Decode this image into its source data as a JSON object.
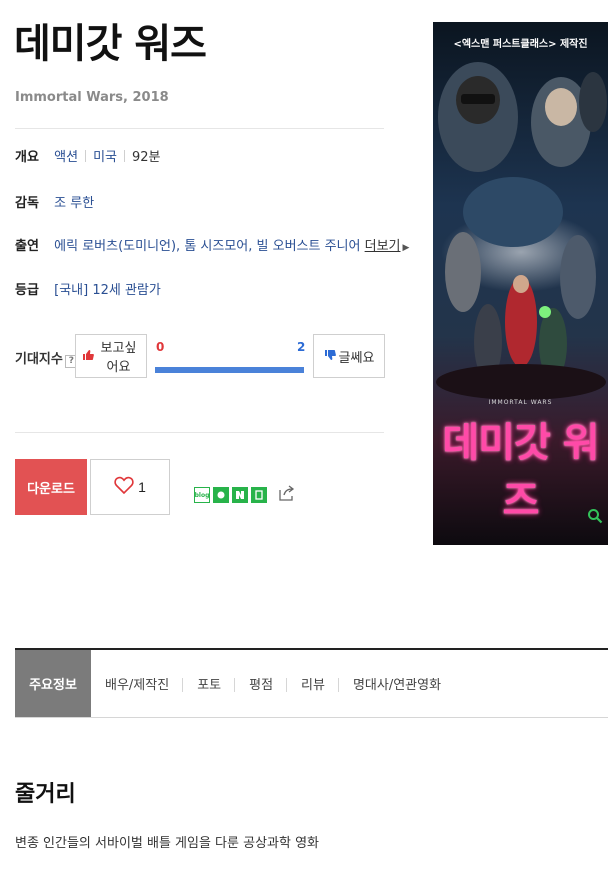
{
  "movie": {
    "title": "데미갓 워즈",
    "subtitle": "Immortal Wars, 2018"
  },
  "info": {
    "overview_label": "개요",
    "genre": "액션",
    "country": "미국",
    "runtime": "92분",
    "director_label": "감독",
    "director": "조 루한",
    "cast_label": "출연",
    "cast": "에릭 로버츠(도미니언), 톰 시즈모어, 빌 오버스트 주니어",
    "more": "더보기",
    "rating_label": "등급",
    "rating": "[국내] 12세 관람가"
  },
  "expectation": {
    "label": "기대지수",
    "help": "?",
    "want_label": "보고싶어요",
    "no_label": "글쎄요",
    "want_count": "0",
    "no_count": "2",
    "no_fraction": 1.0
  },
  "actions": {
    "download_label": "다운로드",
    "like_count": "1"
  },
  "poster": {
    "tagline": "<엑스맨 퍼스트클래스> 제작진",
    "logo_sub": "IMMORTAL WARS",
    "title": "데미갓 워즈"
  },
  "tabs": [
    {
      "label": "주요정보"
    },
    {
      "label": "배우/제작진"
    },
    {
      "label": "포토"
    },
    {
      "label": "평점"
    },
    {
      "label": "리뷰"
    },
    {
      "label": "명대사/연관영화"
    }
  ],
  "synopsis": {
    "heading": "줄거리",
    "text": "변종 인간들의 서바이벌 배틀 게임을 다룬 공상과학 영화"
  },
  "colors": {
    "download_bg": "#e25253",
    "link": "#2a4f93",
    "gauge": "#4a82d9",
    "tab_active": "#7b7b7b"
  },
  "icons": {
    "like": "heart-icon",
    "want": "thumb-up-icon",
    "no": "thumb-down-icon",
    "share": "share-icon",
    "zoom": "magnifier-icon"
  }
}
